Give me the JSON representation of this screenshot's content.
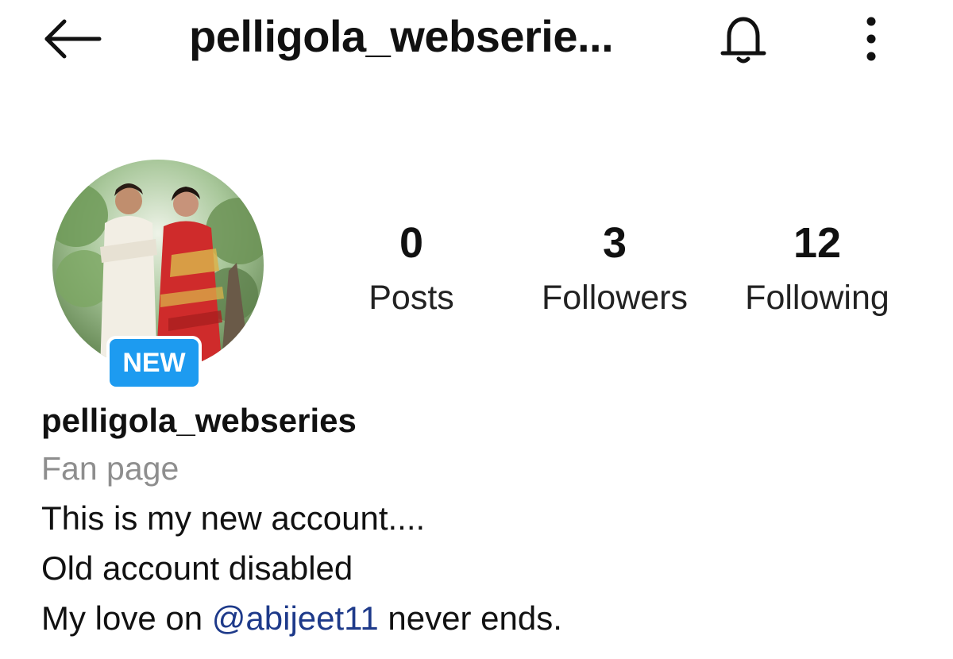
{
  "header": {
    "title": "pelligola_webserie...",
    "back_icon": "arrow-left-icon",
    "bell_icon": "bell-icon",
    "more_icon": "more-vertical-icon"
  },
  "profile": {
    "avatar_badge": "NEW",
    "stats": [
      {
        "value": "0",
        "label": "Posts"
      },
      {
        "value": "3",
        "label": "Followers"
      },
      {
        "value": "12",
        "label": "Following"
      }
    ]
  },
  "bio": {
    "name": "pelligola_webseries",
    "category": "Fan page",
    "line1": "This is my new account....",
    "line2": "Old account disabled",
    "line3_prefix": "My love on ",
    "line3_mention": "@abijeet11",
    "line3_suffix": " never ends."
  },
  "colors": {
    "badge": "#1d9bf0",
    "mention": "#1e3a8a",
    "category": "#8e8e8e"
  }
}
